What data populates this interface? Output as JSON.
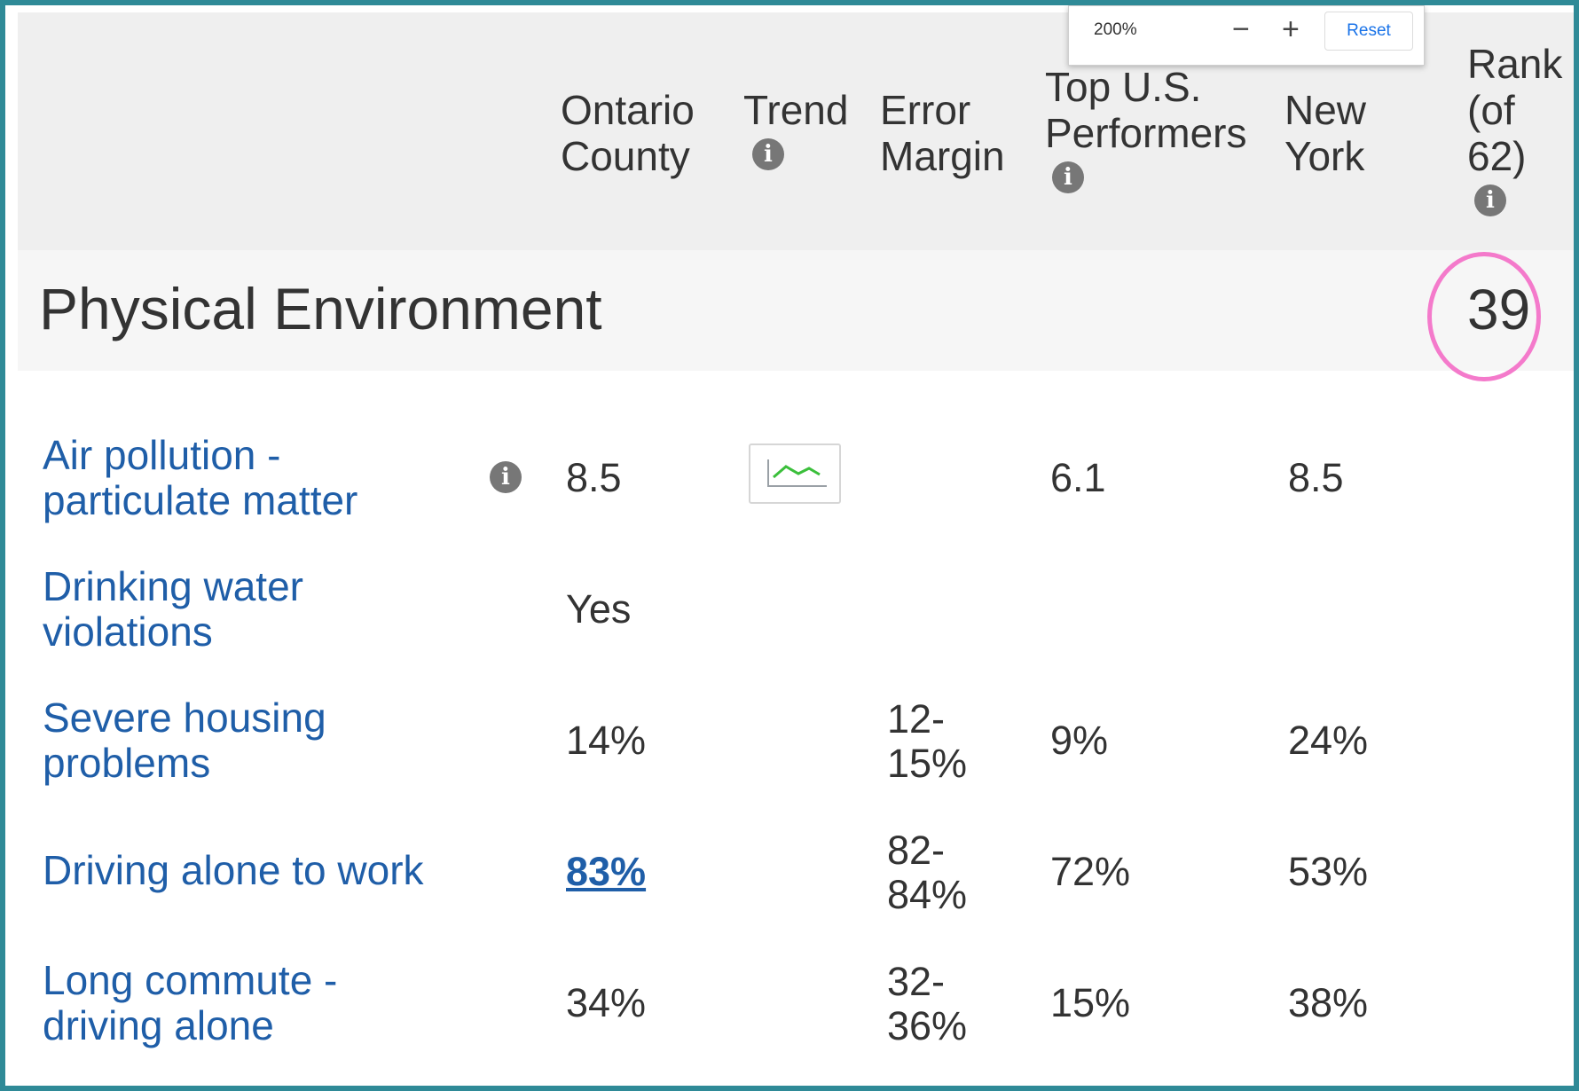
{
  "zoom": {
    "level": "200%",
    "minus": "−",
    "plus": "+",
    "reset": "Reset"
  },
  "columns": {
    "county": [
      "Ontario",
      "County"
    ],
    "trend": "Trend",
    "error": [
      "Error",
      "Margin"
    ],
    "top": [
      "Top U.S.",
      "Performers"
    ],
    "state": [
      "New",
      "York"
    ],
    "rank": [
      "Rank",
      "(of",
      "62)"
    ]
  },
  "info_icon": "i",
  "section": {
    "title": "Physical Environment",
    "rank": "39"
  },
  "rows": [
    {
      "measure": [
        "Air pollution -",
        "particulate matter"
      ],
      "county": "8.5",
      "error": [],
      "top": "6.1",
      "state": "8.5",
      "has_info": true,
      "has_trend": true
    },
    {
      "measure": [
        "Drinking water",
        "violations"
      ],
      "county": "Yes",
      "error": [],
      "top": "",
      "state": ""
    },
    {
      "measure": [
        "Severe housing",
        "problems"
      ],
      "county": "14%",
      "error": [
        "12-",
        "15%"
      ],
      "top": "9%",
      "state": "24%"
    },
    {
      "measure": [
        "Driving alone to work"
      ],
      "county": "83%",
      "county_link": true,
      "error": [
        "82-",
        "84%"
      ],
      "top": "72%",
      "state": "53%"
    },
    {
      "measure": [
        "Long commute -",
        "driving alone"
      ],
      "county": "34%",
      "error": [
        "32-",
        "36%"
      ],
      "top": "15%",
      "state": "38%"
    }
  ],
  "colors": {
    "border": "#2f8a97",
    "link": "#1f5ea8",
    "highlight_circle": "#f47acb",
    "trend_line": "#3bbf3b"
  }
}
